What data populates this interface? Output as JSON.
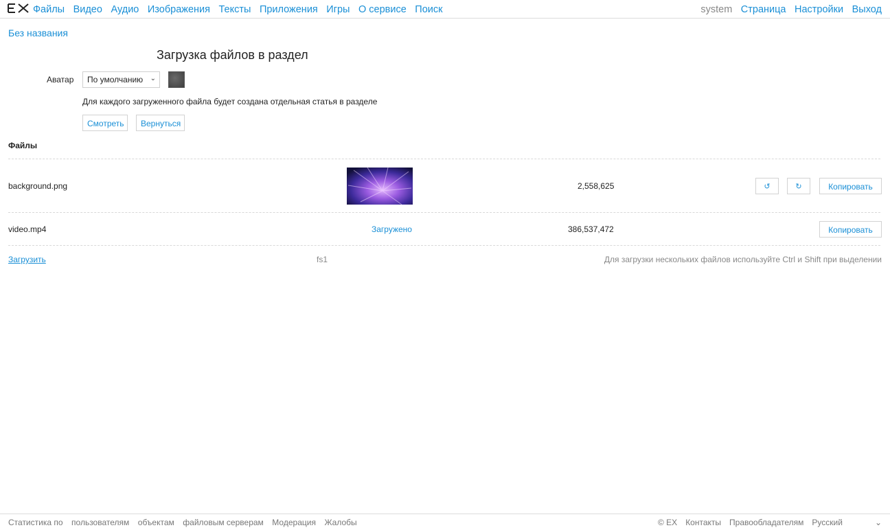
{
  "nav": {
    "logo": "EX",
    "items": [
      "Файлы",
      "Видео",
      "Аудио",
      "Изображения",
      "Тексты",
      "Приложения",
      "Игры",
      "О сервисе",
      "Поиск"
    ],
    "user": "system",
    "right_items": [
      "Страница",
      "Настройки",
      "Выход"
    ]
  },
  "breadcrumb": "Без названия",
  "title": "Загрузка файлов в раздел",
  "avatar": {
    "label": "Аватар",
    "selected": "По умолчанию"
  },
  "note": "Для каждого загруженного файла будет создана отдельная статья в разделе",
  "buttons": {
    "view": "Смотреть",
    "back": "Вернуться"
  },
  "files": {
    "title": "Файлы",
    "rows": [
      {
        "name": "background.png",
        "status": "",
        "size": "2,558,625",
        "rotate_left": "↺",
        "rotate_right": "↻",
        "copy": "Копировать"
      },
      {
        "name": "video.mp4",
        "status": "Загружено",
        "size": "386,537,472",
        "copy": "Копировать"
      }
    ]
  },
  "upload": {
    "link": "Загрузить",
    "server": "fs1",
    "hint": "Для загрузки нескольких файлов используйте Ctrl и Shift при выделении"
  },
  "footer": {
    "left": [
      "Статистика по",
      "пользователям",
      "объектам",
      "файловым серверам",
      "Модерация",
      "Жалобы"
    ],
    "copyright": "© EX",
    "contacts": "Контакты",
    "rightholders": "Правообладателям",
    "language": "Русский"
  },
  "colors": {
    "link": "#1a8fd6",
    "muted": "#888888",
    "border": "#dcdcdc"
  }
}
